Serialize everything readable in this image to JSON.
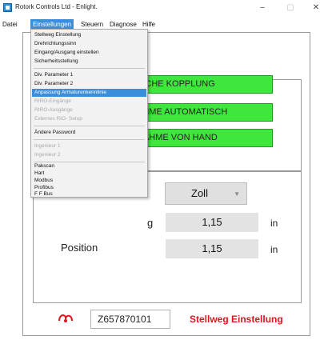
{
  "window": {
    "title": "Rotork Controls Ltd - Enlight.",
    "controls": {
      "minimize": "–",
      "maximize": "▢",
      "close": "✕"
    }
  },
  "menubar": [
    "Datei",
    "Einstellungen",
    "Steuern",
    "Diagnose",
    "Hilfe"
  ],
  "dropdown_menu": {
    "items": [
      {
        "label": "Stellweg Einstellung",
        "enabled": true
      },
      {
        "label": "Drehrichtungssinn",
        "enabled": true
      },
      {
        "label": "Eingang/Ausgang einstellen",
        "enabled": true
      },
      {
        "label": "Sicherheitsstellung",
        "enabled": true
      },
      {
        "label": "Div. Parameter 1",
        "enabled": true
      },
      {
        "label": "Div. Parameter 2",
        "enabled": true
      },
      {
        "label": "Anpassung Armaturenkennlinie",
        "enabled": true,
        "highlighted": true
      },
      {
        "label": "RIRO-Eingänge",
        "enabled": false
      },
      {
        "label": "RIRO-Ausgänge",
        "enabled": false
      },
      {
        "label": "Externes RIO- Setup",
        "enabled": false
      },
      {
        "label": "Ändere Password",
        "enabled": true
      },
      {
        "label": "Ingenieur 1",
        "enabled": false
      },
      {
        "label": "Ingenieur 2",
        "enabled": false
      },
      {
        "label": "Pakscan",
        "enabled": true
      },
      {
        "label": "Hart",
        "enabled": true
      },
      {
        "label": "Modbus",
        "enabled": true
      },
      {
        "label": "Profibus",
        "enabled": true
      },
      {
        "label": "F F Bus",
        "enabled": true
      }
    ]
  },
  "green_buttons": [
    "ISCHE KOPPLUNG",
    "AHME AUTOMATISCH",
    "NAHME VON HAND"
  ],
  "unit_select": {
    "value": "Zoll",
    "arrow": "▼"
  },
  "rows": [
    {
      "label": "g",
      "value": "1,15",
      "unit": "in"
    },
    {
      "label": "Position",
      "value": "1,15",
      "unit": "in"
    }
  ],
  "footer": {
    "serial": "Z657870101",
    "status": "Stellweg Einstellung"
  },
  "colors": {
    "accent": "#3b8ed9",
    "green": "#3ee63e",
    "status_red": "#e0141e",
    "menu_bg": "#f2f2f2"
  },
  "icons": [
    "app-icon",
    "rotork-logo-icon",
    "chevron-down-icon"
  ]
}
